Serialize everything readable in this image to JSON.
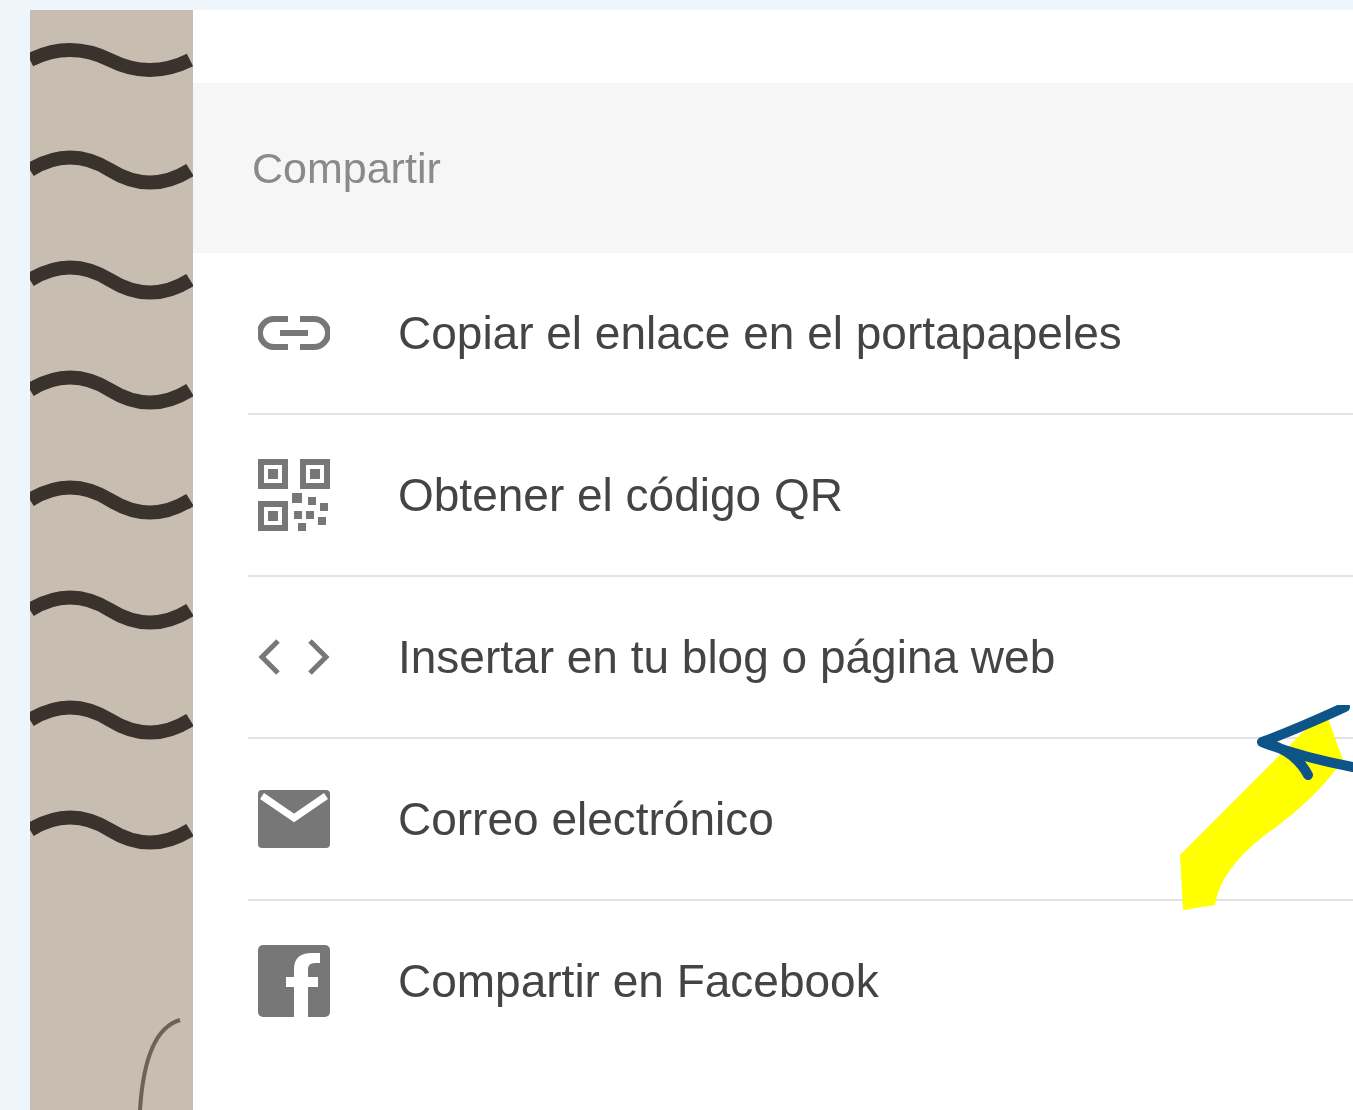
{
  "share_menu": {
    "title": "Compartir",
    "items": [
      {
        "kind": "link",
        "label": "Copiar el enlace en el portapapeles"
      },
      {
        "kind": "qr",
        "label": "Obtener el código QR"
      },
      {
        "kind": "embed",
        "label": "Insertar en tu blog o página web"
      },
      {
        "kind": "email",
        "label": "Correo electrónico"
      },
      {
        "kind": "facebook",
        "label": "Compartir en Facebook"
      }
    ]
  }
}
